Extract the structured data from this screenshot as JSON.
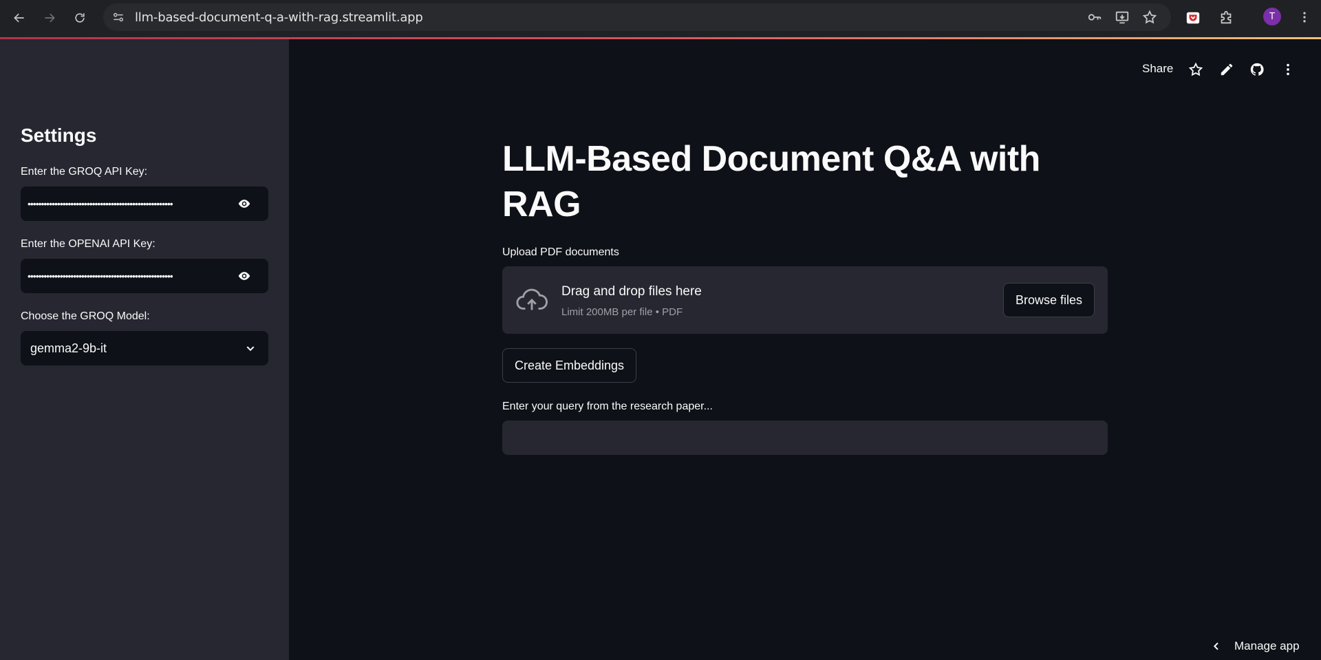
{
  "browser": {
    "url": "llm-based-document-q-a-with-rag.streamlit.app",
    "profile_initial": "T"
  },
  "sidebar": {
    "title": "Settings",
    "groq_label": "Enter the GROQ API Key:",
    "groq_value": "••••••••••••••••••••••••••••••••••••••••••••••••••••••",
    "openai_label": "Enter the OPENAI API Key:",
    "openai_value": "••••••••••••••••••••••••••••••••••••••••••••••••••••••",
    "model_label": "Choose the GROQ Model:",
    "model_value": "gemma2-9b-it"
  },
  "toolbar": {
    "share_label": "Share"
  },
  "main": {
    "title": "LLM-Based Document Q&A with RAG",
    "upload_label": "Upload PDF documents",
    "dropzone_title": "Drag and drop files here",
    "dropzone_sub": "Limit 200MB per file • PDF",
    "browse_label": "Browse files",
    "embeddings_label": "Create Embeddings",
    "query_label": "Enter your query from the research paper...",
    "query_value": ""
  },
  "footer": {
    "manage_label": "Manage app"
  },
  "colors": {
    "background": "#0e1117",
    "sidebar": "#262730",
    "text": "#fafafa",
    "muted": "#9ea0a6"
  }
}
